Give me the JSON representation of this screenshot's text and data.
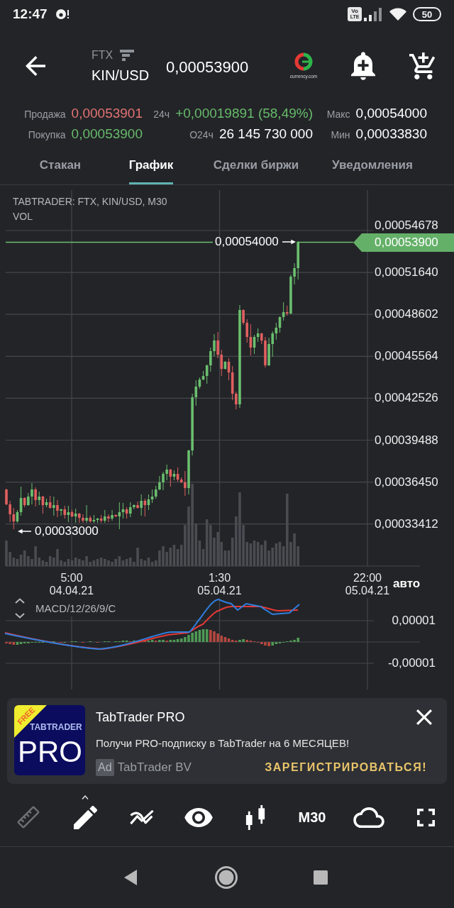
{
  "status_bar": {
    "time": "12:47",
    "network_badge": {
      "top": "Vo",
      "bottom": "LTE"
    },
    "battery": "50"
  },
  "header": {
    "exchange": "FTX",
    "pair": "KIN/USD",
    "price": "0,00053900",
    "partner_caption": "currency.com"
  },
  "stats": [
    [
      {
        "label": "Продажа",
        "value": "0,00053901",
        "color": "#e57373"
      },
      {
        "label": "24ч",
        "value": "+0,00019891 (58,49%)",
        "color": "#66bb6a"
      },
      {
        "label": "Макс",
        "value": "0,00054000",
        "color": "#ffffff"
      }
    ],
    [
      {
        "label": "Покупка",
        "value": "0,00053900",
        "color": "#66bb6a"
      },
      {
        "label": "О24ч",
        "value": "26 145 730 000",
        "color": "#ffffff"
      },
      {
        "label": "Мин",
        "value": "0,00033830",
        "color": "#ffffff"
      }
    ]
  ],
  "tabs": [
    {
      "label": "Стакан",
      "selected": false
    },
    {
      "label": "График",
      "selected": true
    },
    {
      "label": "Сделки биржи",
      "selected": false
    },
    {
      "label": "Уведомления",
      "selected": false
    }
  ],
  "price_chart": {
    "legend": [
      "TABTRADER: FTX, KIN/USD, M30",
      "VOL"
    ],
    "y_labels": [
      "0,00054678",
      "0,00051640",
      "0,00048602",
      "0,00045564",
      "0,00042526",
      "0,00039488",
      "0,00036450",
      "0,00033412"
    ],
    "last_price": "0,00053900",
    "high_marker": "0,00054000",
    "low_marker": "0,00033000",
    "x_labels": [
      {
        "time": "5:00",
        "date": "04.04.21"
      },
      {
        "time": "1:30",
        "date": "05.04.21"
      },
      {
        "time": "22:00",
        "date": "05.04.21"
      }
    ],
    "scale_mode": "авто"
  },
  "macd": {
    "label": "MACD/12/26/9/C",
    "y_labels": [
      "0,00001",
      "-0,00001"
    ]
  },
  "ad": {
    "logo": {
      "ribbon": "FREE",
      "brand": "TABTRADER",
      "product": "PRO"
    },
    "title": "TabTrader PRO",
    "text": "Получи PRO-подписку в TabTrader на 6 МЕСЯЦЕВ!",
    "badge": "Ad",
    "advertiser": "TabTrader BV",
    "cta": "ЗАРЕГИСТРИРОВАТЬСЯ!"
  },
  "toolbar": [
    {
      "kind": "ruler",
      "disabled": true,
      "submenu": false
    },
    {
      "kind": "draw",
      "disabled": false,
      "submenu": true
    },
    {
      "kind": "indicators",
      "disabled": false,
      "submenu": false
    },
    {
      "kind": "visibility",
      "disabled": false,
      "submenu": false
    },
    {
      "kind": "chart_type",
      "disabled": false,
      "submenu": false
    },
    {
      "kind": "timeframe",
      "label": "M30",
      "disabled": false,
      "submenu": false
    },
    {
      "kind": "cloud",
      "disabled": false,
      "submenu": false
    },
    {
      "kind": "fullscreen",
      "disabled": false,
      "submenu": false
    }
  ]
}
